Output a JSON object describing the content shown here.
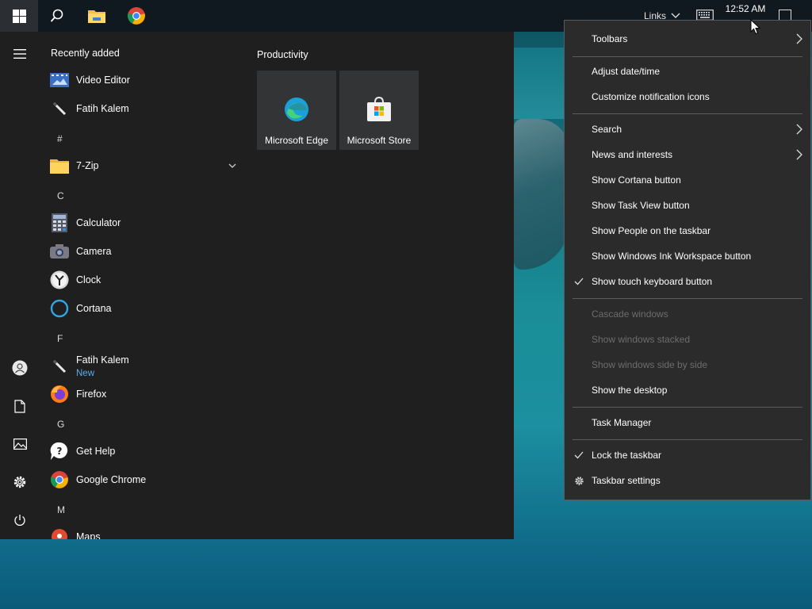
{
  "taskbar": {
    "icons": [
      "windows-logo-icon",
      "search-icon",
      "file-explorer-icon",
      "chrome-icon"
    ],
    "links_label": "Links",
    "clock": "12:52 AM"
  },
  "start_menu": {
    "recently_added_label": "Recently added",
    "productivity_label": "Productivity",
    "rail_icons": [
      "hamburger-icon",
      "user-icon",
      "documents-icon",
      "pictures-icon",
      "settings-icon",
      "power-icon"
    ],
    "apps": {
      "video_editor": "Video Editor",
      "fatih_kalem_1": "Fatih Kalem",
      "letter_hash": "#",
      "zip": "7-Zip",
      "letter_c": "C",
      "calculator": "Calculator",
      "camera": "Camera",
      "clock": "Clock",
      "cortana": "Cortana",
      "letter_f": "F",
      "fatih_kalem_2": "Fatih Kalem",
      "fatih_kalem_2_badge": "New",
      "firefox": "Firefox",
      "letter_g": "G",
      "get_help": "Get Help",
      "google_chrome": "Google Chrome",
      "letter_m": "M",
      "maps": "Maps"
    },
    "tiles": {
      "edge": "Microsoft Edge",
      "store": "Microsoft Store"
    }
  },
  "context_menu": {
    "toolbars": "Toolbars",
    "adjust_datetime": "Adjust date/time",
    "customize_notification": "Customize notification icons",
    "search": "Search",
    "news_interests": "News and interests",
    "show_cortana": "Show Cortana button",
    "show_task_view": "Show Task View button",
    "show_people": "Show People on the taskbar",
    "show_ink": "Show Windows Ink Workspace button",
    "show_touch_keyboard": "Show touch keyboard button",
    "cascade": "Cascade windows",
    "stacked": "Show windows stacked",
    "side_by_side": "Show windows side by side",
    "show_desktop": "Show the desktop",
    "task_manager": "Task Manager",
    "lock_taskbar": "Lock the taskbar",
    "taskbar_settings": "Taskbar settings"
  },
  "colors": {
    "start_bg": "#1f1f1f",
    "menu_bg": "#2b2b2b",
    "accent_link": "#5aaef0",
    "disabled_text": "#6d6d6d"
  }
}
